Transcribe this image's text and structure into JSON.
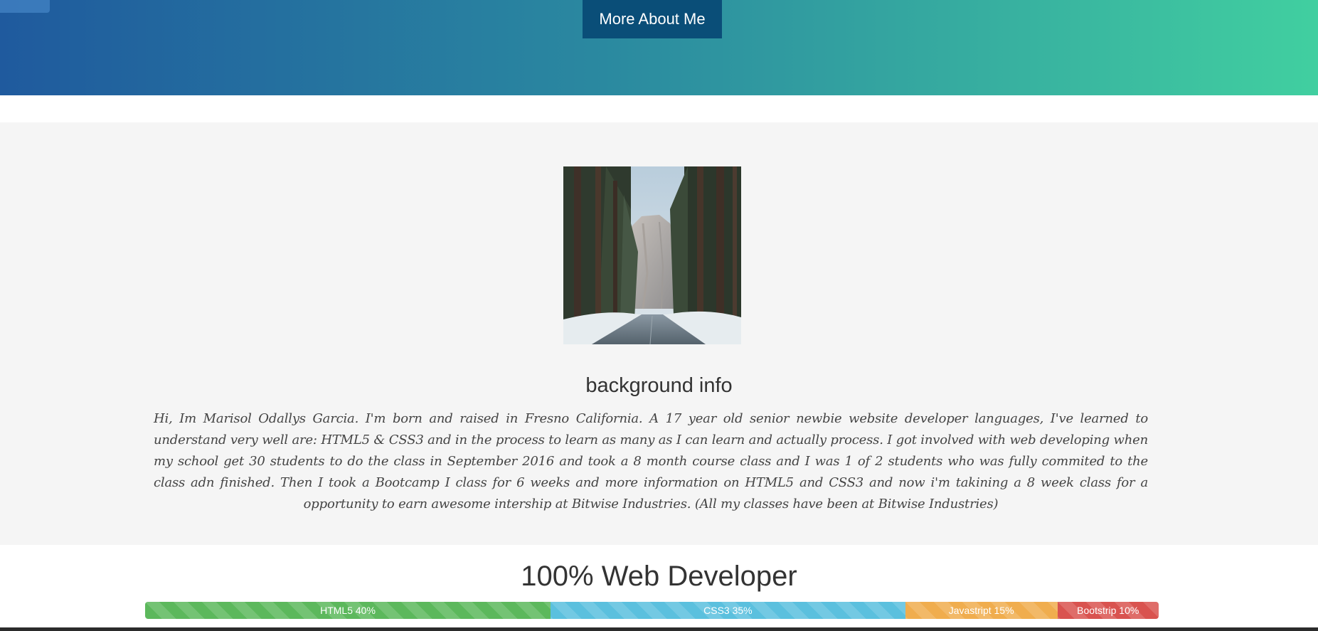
{
  "hero": {
    "button_label": "More About Me",
    "gradient_colors": [
      "#1f5a9e",
      "#41cfa0"
    ],
    "button_color": "#0a4e78"
  },
  "about": {
    "photo_icon": "winter-road-forest-photo",
    "title": "background info",
    "text": "Hi, Im Marisol Odallys Garcia. I'm born and raised in Fresno California. A 17 year old senior newbie website developer languages, I've learned to understand very well are: HTML5 & CSS3 and in the process to learn as many as I can learn and actually process. I got involved with web developing when my school get 30 students to do the class in September 2016 and took a 8 month course class and I was 1 of 2 students who was fully commited to the class adn finished. Then I took a Bootcamp I class for 6 weeks and more information on HTML5 and CSS3 and now i'm takining a 8 week class for a opportunity to earn awesome intership at Bitwise Industries. (All my classes have been at Bitwise Industries)"
  },
  "skills": {
    "title": "100% Web Developer",
    "bars": [
      {
        "label": "HTML5 40%",
        "percent": 40,
        "color": "#5cb85c"
      },
      {
        "label": "CSS3 35%",
        "percent": 35,
        "color": "#5bc0de"
      },
      {
        "label": "Javastript 15%",
        "percent": 15,
        "color": "#f0ad4e"
      },
      {
        "label": "Bootstrip 10%",
        "percent": 10,
        "color": "#d9534f"
      }
    ]
  }
}
